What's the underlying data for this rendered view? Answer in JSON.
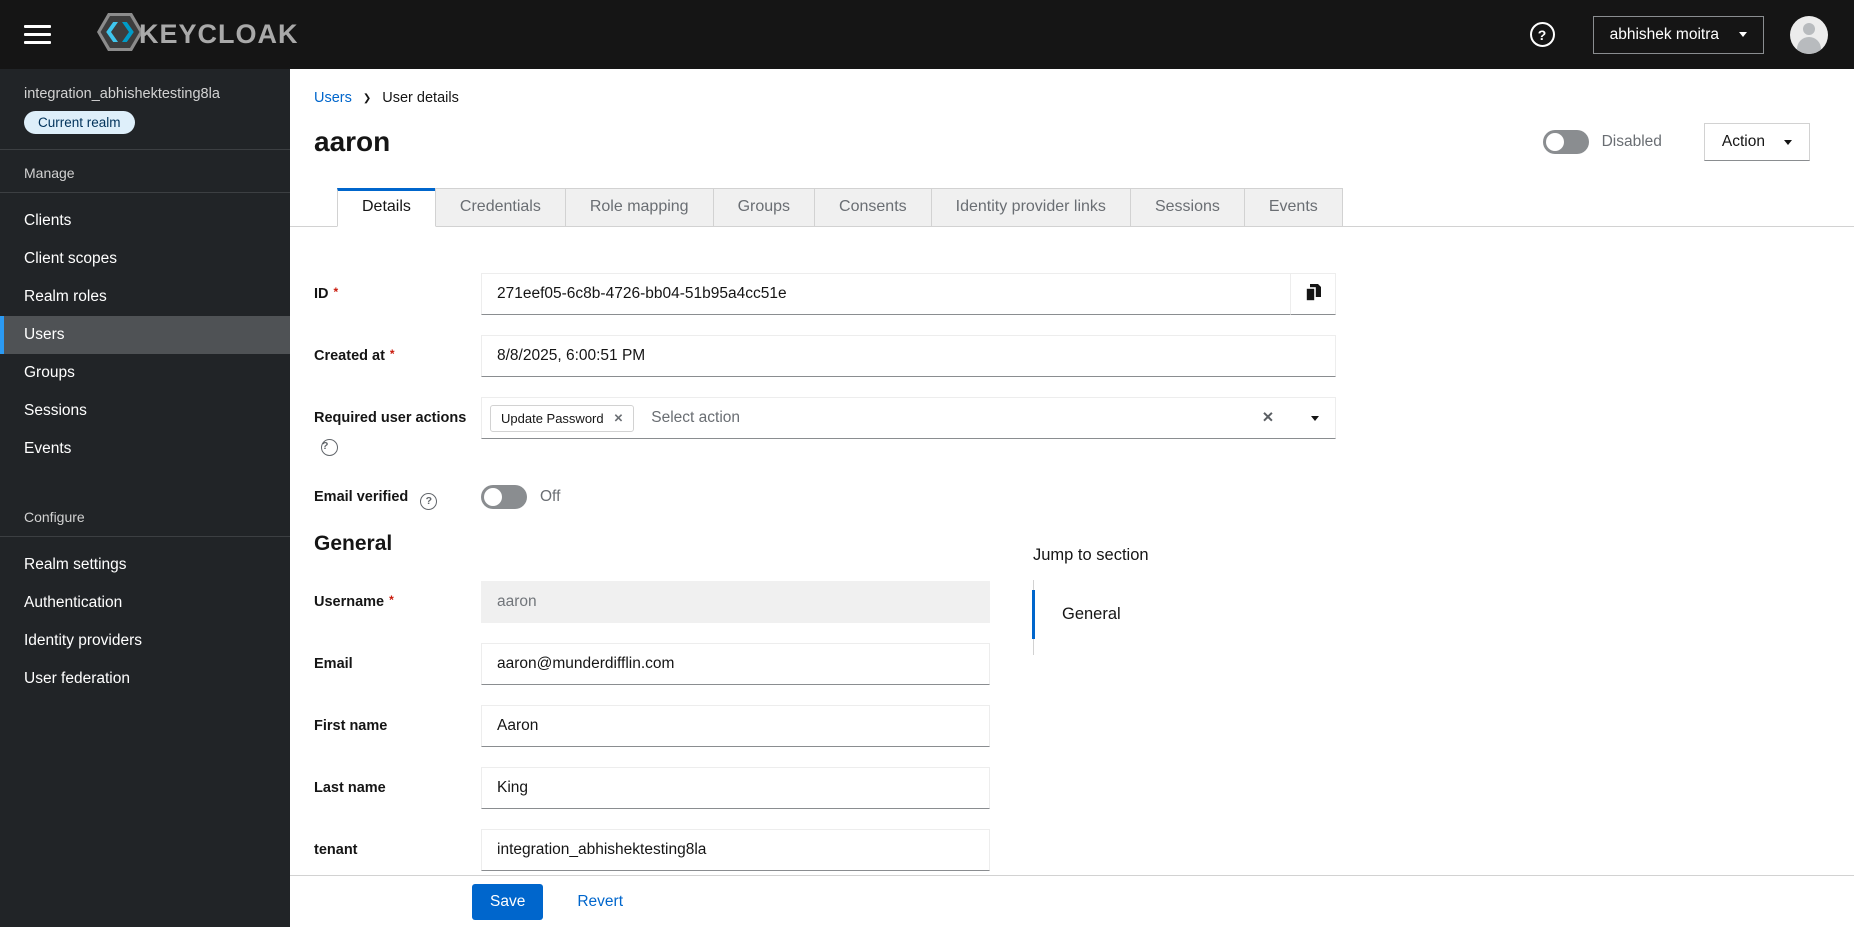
{
  "colors": {
    "accent": "#0066cc",
    "masthead_bg": "#151515",
    "sidebar_bg": "#212427",
    "selected_nav_bg": "#4f5255",
    "selected_nav_bar": "#2b9af3",
    "badge_bg": "#deeffa",
    "badge_text": "#00325a",
    "danger": "#c9190b"
  },
  "icons": {
    "help": "?",
    "close": "✕",
    "breadcrumb_separator": "❯"
  },
  "masthead": {
    "brand": "KEYCLOAK",
    "user_name": "abhishek moitra"
  },
  "sidebar": {
    "realm_name": "integration_abhishektesting8la",
    "realm_badge": "Current realm",
    "manage_label": "Manage",
    "manage": [
      "Clients",
      "Client scopes",
      "Realm roles",
      "Users",
      "Groups",
      "Sessions",
      "Events"
    ],
    "configure_label": "Configure",
    "configure": [
      "Realm settings",
      "Authentication",
      "Identity providers",
      "User federation"
    ]
  },
  "breadcrumb": {
    "root": "Users",
    "current": "User details"
  },
  "header": {
    "title": "aaron",
    "status": "Disabled",
    "action": "Action"
  },
  "tabs": [
    "Details",
    "Credentials",
    "Role mapping",
    "Groups",
    "Consents",
    "Identity provider links",
    "Sessions",
    "Events"
  ],
  "form": {
    "required_marker": "*",
    "id": {
      "label": "ID",
      "value": "271eef05-6c8b-4726-bb04-51b95a4cc51e"
    },
    "created_at": {
      "label": "Created at",
      "value": "8/8/2025, 6:00:51 PM"
    },
    "required_actions": {
      "label": "Required user actions",
      "chip": "Update Password",
      "placeholder": "Select action"
    },
    "email_verified": {
      "label": "Email verified",
      "state": "Off"
    },
    "general_heading": "General",
    "username": {
      "label": "Username",
      "value": "aaron"
    },
    "email": {
      "label": "Email",
      "value": "aaron@munderdifflin.com"
    },
    "first_name": {
      "label": "First name",
      "value": "Aaron"
    },
    "last_name": {
      "label": "Last name",
      "value": "King"
    },
    "tenant": {
      "label": "tenant",
      "value": "integration_abhishektesting8la"
    }
  },
  "jump": {
    "heading": "Jump to section",
    "items": [
      "General"
    ]
  },
  "footer": {
    "save": "Save",
    "revert": "Revert"
  }
}
